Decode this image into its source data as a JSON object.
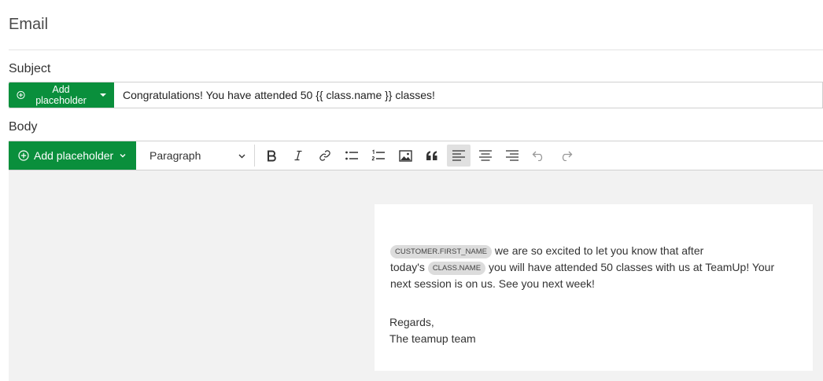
{
  "header": {
    "title": "Email"
  },
  "subject": {
    "label": "Subject",
    "placeholder_button": "Add placeholder",
    "value": "Congratulations! You have attended 50 {{ class.name }} classes!"
  },
  "body": {
    "label": "Body",
    "placeholder_button": "Add placeholder",
    "block_format": "Paraph",
    "block_format_full": "Paragraph"
  },
  "toolbar": {
    "icons": [
      "bold-icon",
      "italic-icon",
      "link-icon",
      "bullet-list-icon",
      "numbered-list-icon",
      "image-icon",
      "blockquote-icon",
      "align-left-icon",
      "align-center-icon",
      "align-right-icon",
      "undo-icon",
      "redo-icon"
    ],
    "active": "align-left-icon"
  },
  "content": {
    "token_customer": "CUSTOMER.FIRST_NAME",
    "line1": " we are so excited to let you know that after",
    "line2_pre": "today's ",
    "token_class": "CLASS.NAME",
    "line2_post": " you will have attended 50 classes with us at  TeamUp! Your next session is on us. See you next week!",
    "sign_regards": "Regards,",
    "sign_team": "The teamup team"
  },
  "colors": {
    "brand_green": "#0a8f3c",
    "editor_bg": "#f2f2f2"
  }
}
